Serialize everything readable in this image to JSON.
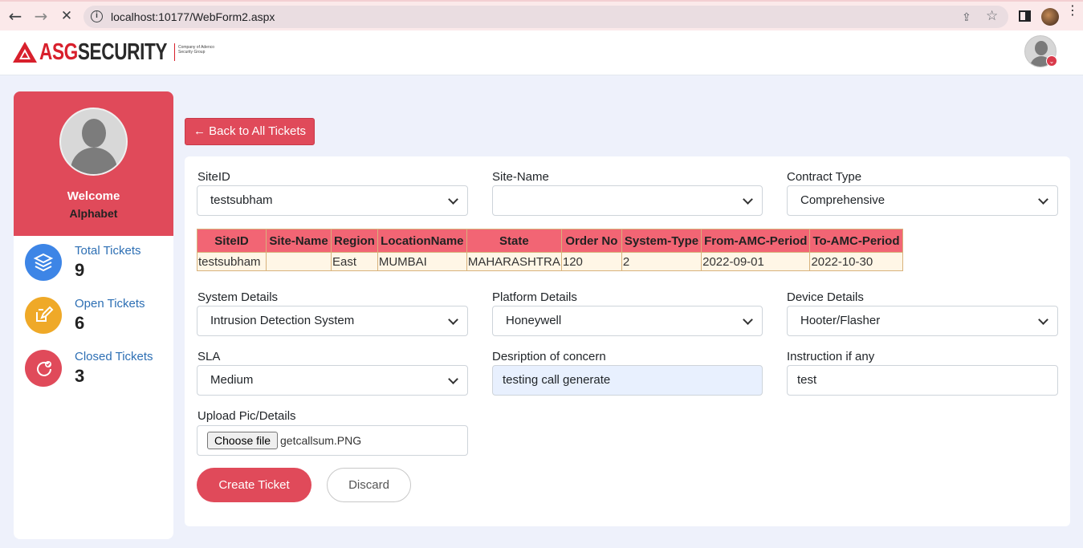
{
  "browser": {
    "url": "localhost:10177/WebForm2.aspx",
    "back_glyph": "←",
    "forward_glyph": "→",
    "stop_glyph": "✕",
    "info_glyph": "i",
    "share_glyph": "⇪",
    "star_glyph": "☆",
    "kebab_glyph": "⋮"
  },
  "brand": {
    "part1": "ASG",
    "part2": "SECURITY",
    "tagline": "Company of Adenco Security Group",
    "color_primary": "#d8202c"
  },
  "header": {
    "badge_glyph": "⌄"
  },
  "sidebar": {
    "welcome": "Welcome",
    "username": "Alphabet",
    "stats": [
      {
        "label": "Total Tickets",
        "count": "9",
        "color": "#3d85e6",
        "icon": "layers-icon",
        "glyph": "≋"
      },
      {
        "label": "Open Tickets",
        "count": "6",
        "color": "#efa928",
        "icon": "edit-icon",
        "glyph": "✎"
      },
      {
        "label": "Closed Tickets",
        "count": "3",
        "color": "#e04a5a",
        "icon": "closed-ticket-icon",
        "glyph": "✓"
      }
    ]
  },
  "main": {
    "back_button": "← Back to All Tickets",
    "fields": {
      "siteid": {
        "label": "SiteID",
        "value": "testsubham"
      },
      "sitename": {
        "label": "Site-Name",
        "value": ""
      },
      "contract": {
        "label": "Contract Type",
        "value": "Comprehensive"
      },
      "system": {
        "label": "System Details",
        "value": "Intrusion Detection System"
      },
      "platform": {
        "label": "Platform Details",
        "value": "Honeywell"
      },
      "device": {
        "label": "Device Details",
        "value": "Hooter/Flasher"
      },
      "sla": {
        "label": "SLA",
        "value": "Medium"
      },
      "description": {
        "label": "Desription of concern",
        "value": "testing call generate"
      },
      "instruction": {
        "label": "Instruction if any",
        "value": "test"
      },
      "upload": {
        "label": "Upload Pic/Details",
        "button": "Choose file",
        "filename": "getcallsum.PNG"
      }
    },
    "table": {
      "headers": [
        "SiteID",
        "Site-Name",
        "Region",
        "LocationName",
        "State",
        "Order No",
        "System-Type",
        "From-AMC-Period",
        "To-AMC-Period"
      ],
      "rows": [
        [
          "testsubham",
          "",
          "East",
          "MUMBAI",
          "MAHARASHTRA",
          "120",
          "2",
          "2022-09-01",
          "2022-10-30"
        ]
      ]
    },
    "create_button": "Create Ticket",
    "discard_button": "Discard"
  }
}
